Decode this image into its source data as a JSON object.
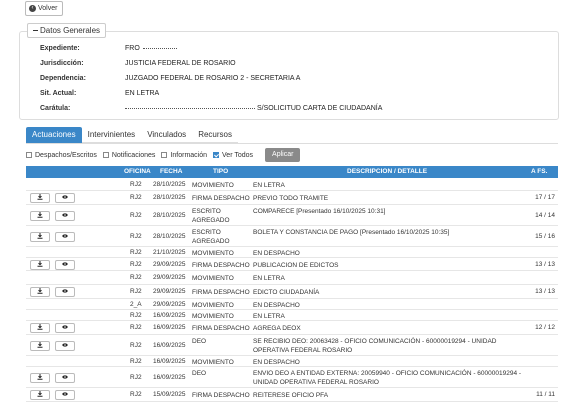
{
  "volver": {
    "label": "Volver"
  },
  "datos": {
    "legend": "Datos Generales",
    "fields": [
      {
        "label": "Expediente:",
        "value": "FRO"
      },
      {
        "label": "Jurisdicción:",
        "value": "JUSTICIA FEDERAL DE ROSARIO"
      },
      {
        "label": "Dependencia:",
        "value": "JUZGADO FEDERAL DE ROSARIO 2 - SECRETARIA A"
      },
      {
        "label": "Sit. Actual:",
        "value": "EN LETRA"
      },
      {
        "label": "Carátula:",
        "value": "S/SOLICITUD CARTA DE CIUDADANÍA"
      }
    ]
  },
  "tabs": [
    "Actuaciones",
    "Intervinientes",
    "Vinculados",
    "Recursos"
  ],
  "filters": [
    {
      "label": "Despachos/Escritos",
      "checked": false
    },
    {
      "label": "Notificaciones",
      "checked": false
    },
    {
      "label": "Información",
      "checked": false
    },
    {
      "label": "Ver Todos",
      "checked": true
    }
  ],
  "aplicar": "Aplicar",
  "table": {
    "headers": {
      "oficina": "OFICINA",
      "fecha": "FECHA",
      "tipo": "TIPO",
      "desc": "DESCRIPCION / DETALLE",
      "afs": "A FS."
    },
    "rows": [
      {
        "btns": false,
        "oficina": "RJ2",
        "fecha": "28/10/2025",
        "tipo": "MOVIMIENTO",
        "desc": "EN LETRA",
        "afs": ""
      },
      {
        "btns": true,
        "oficina": "RJ2",
        "fecha": "28/10/2025",
        "tipo": "FIRMA DESPACHO",
        "desc": "PREVIO TODO TRAMITE",
        "afs": "17 / 17"
      },
      {
        "btns": true,
        "oficina": "RJ2",
        "fecha": "28/10/2025",
        "tipo": "ESCRITO AGREGADO",
        "desc": "COMPARECE [Presentado 16/10/2025 10:31]",
        "afs": "14 / 14"
      },
      {
        "btns": true,
        "oficina": "RJ2",
        "fecha": "28/10/2025",
        "tipo": "ESCRITO AGREGADO",
        "desc": "BOLETA Y CONSTANCIA DE PAGO [Presentado 16/10/2025 10:35]",
        "afs": "15 / 16"
      },
      {
        "btns": false,
        "oficina": "RJ2",
        "fecha": "21/10/2025",
        "tipo": "MOVIMIENTO",
        "desc": "EN DESPACHO",
        "afs": ""
      },
      {
        "btns": true,
        "oficina": "RJ2",
        "fecha": "29/09/2025",
        "tipo": "FIRMA DESPACHO",
        "desc": "PUBLICACION DE EDICTOS",
        "afs": "13 / 13"
      },
      {
        "btns": false,
        "oficina": "RJ2",
        "fecha": "29/09/2025",
        "tipo": "MOVIMIENTO",
        "desc": "EN LETRA",
        "afs": ""
      },
      {
        "btns": true,
        "oficina": "RJ2",
        "fecha": "29/09/2025",
        "tipo": "FIRMA DESPACHO",
        "desc": "EDICTO CIUDADANÍA",
        "afs": "13 / 13"
      },
      {
        "btns": false,
        "oficina": "2_A",
        "fecha": "29/09/2025",
        "tipo": "MOVIMIENTO",
        "desc": "EN DESPACHO",
        "afs": ""
      },
      {
        "btns": false,
        "oficina": "RJ2",
        "fecha": "16/09/2025",
        "tipo": "MOVIMIENTO",
        "desc": "EN LETRA",
        "afs": ""
      },
      {
        "btns": true,
        "oficina": "RJ2",
        "fecha": "16/09/2025",
        "tipo": "FIRMA DESPACHO",
        "desc": "AGREGA DEOX",
        "afs": "12 / 12"
      },
      {
        "btns": true,
        "oficina": "RJ2",
        "fecha": "16/09/2025",
        "tipo": "DEO",
        "desc": "SE RECIBIO DEO: 20063428 - OFICIO COMUNICACIÓN - 60000019294 - UNIDAD OPERATIVA FEDERAL ROSARIO",
        "afs": ""
      },
      {
        "btns": false,
        "oficina": "RJ2",
        "fecha": "16/09/2025",
        "tipo": "MOVIMIENTO",
        "desc": "EN DESPACHO",
        "afs": ""
      },
      {
        "btns": true,
        "oficina": "RJ2",
        "fecha": "16/09/2025",
        "tipo": "DEO",
        "desc": "ENVIO DEO A ENTIDAD EXTERNA: 20059940 - OFICIO COMUNICACIÓN - 60000019294 - UNIDAD OPERATIVA FEDERAL ROSARIO",
        "afs": ""
      },
      {
        "btns": true,
        "oficina": "RJ2",
        "fecha": "15/09/2025",
        "tipo": "FIRMA DESPACHO",
        "desc": "REITERESE OFICIO PFA",
        "afs": "11 / 11"
      }
    ]
  }
}
